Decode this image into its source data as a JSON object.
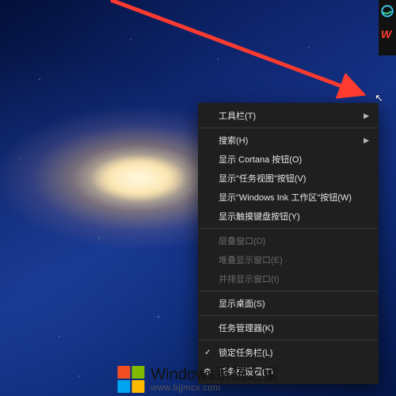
{
  "sidebar": {
    "edge_icon": "edge-icon",
    "wps_icon": "W"
  },
  "context_menu": {
    "items": [
      {
        "label": "工具栏(T)",
        "submenu": true
      },
      {
        "label": "搜索(H)",
        "submenu": true
      },
      {
        "label": "显示 Cortana 按钮(O)"
      },
      {
        "label": "显示\"任务视图\"按钮(V)"
      },
      {
        "label": "显示\"Windows Ink 工作区\"按钮(W)"
      },
      {
        "label": "显示触摸键盘按钮(Y)"
      }
    ],
    "disabled_items": [
      {
        "label": "层叠窗口(D)"
      },
      {
        "label": "堆叠显示窗口(E)"
      },
      {
        "label": "并排显示窗口(I)"
      }
    ],
    "bottom_items": [
      {
        "label": "显示桌面(S)"
      },
      {
        "label": "任务管理器(K)"
      }
    ],
    "lock_item": {
      "label": "锁定任务栏(L)",
      "checked": true
    },
    "settings_item": {
      "label": "任务栏设置(T)",
      "icon": "gear"
    }
  },
  "watermark": {
    "title_prefix": "Windows",
    "title_suffix": "系统之家",
    "url": "www.bjjmcx.com"
  },
  "logo_colors": {
    "tl": "#f25022",
    "tr": "#7fba00",
    "bl": "#00a4ef",
    "br": "#ffb900"
  }
}
